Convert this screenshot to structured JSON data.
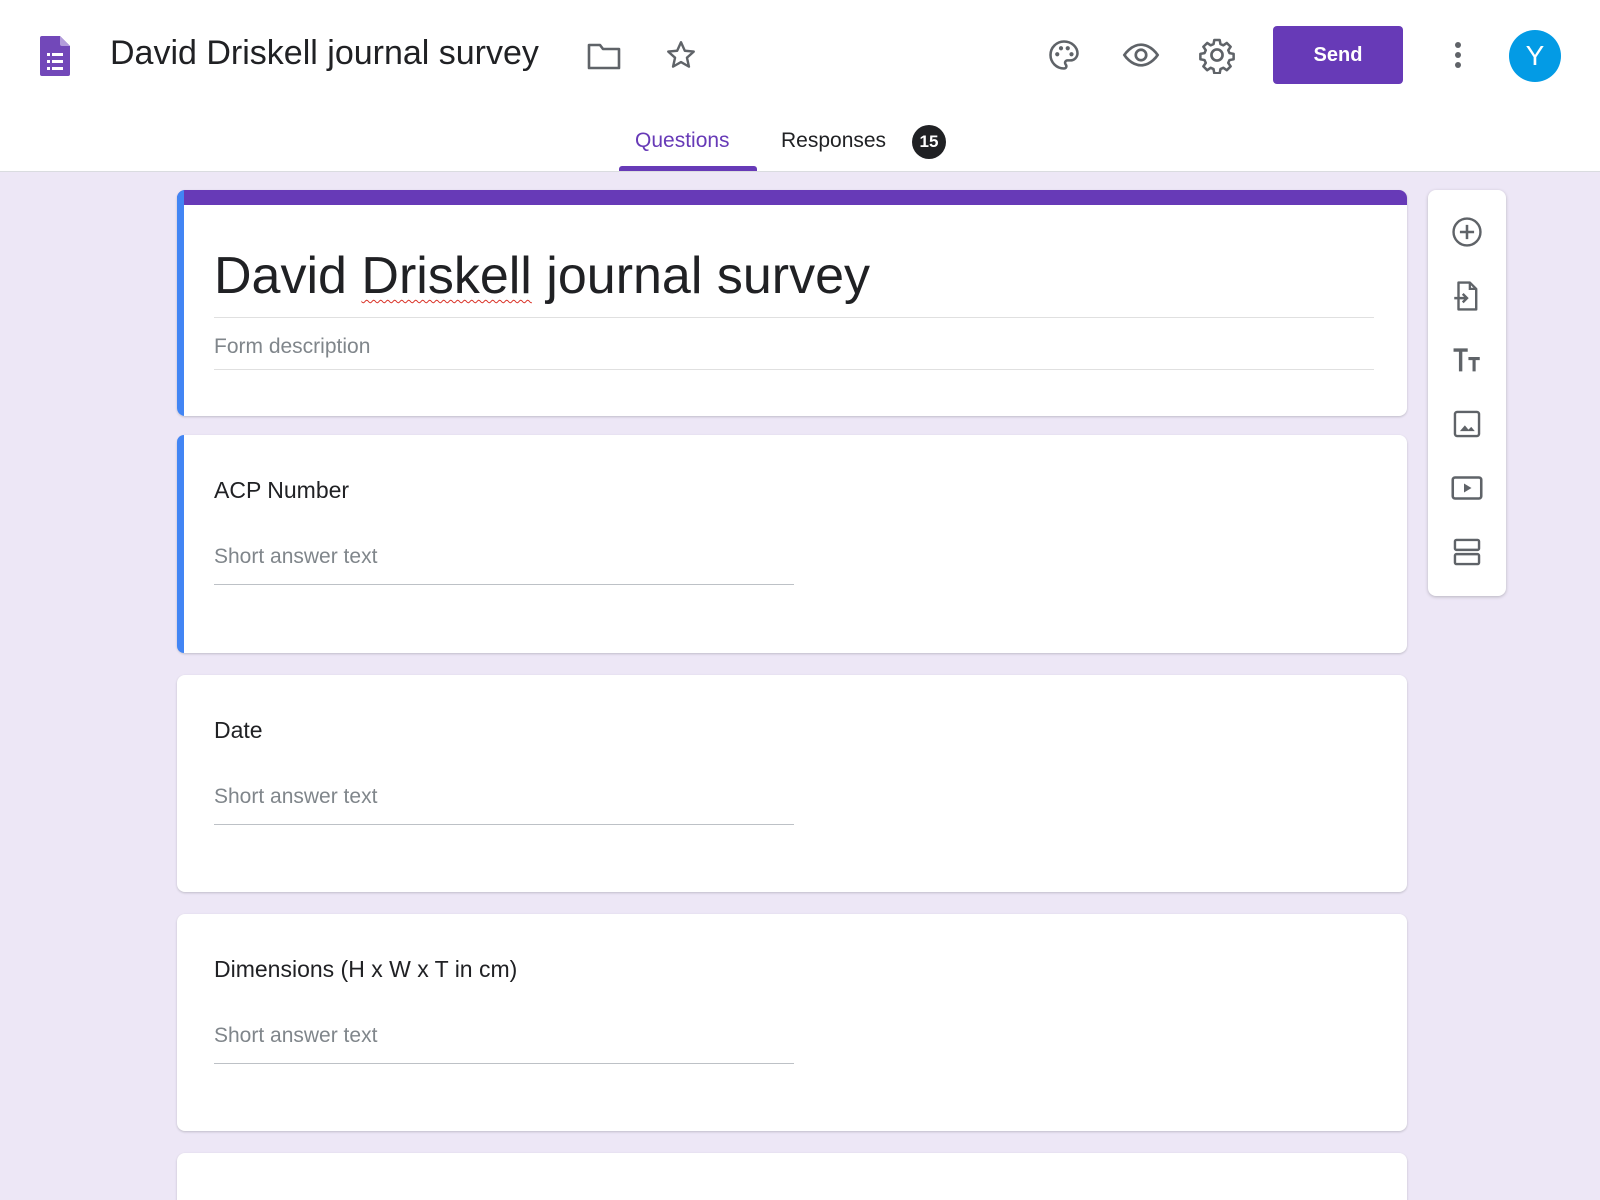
{
  "app": {
    "doc_title": "David Driskell journal survey",
    "send_label": "Send",
    "avatar_letter": "Y",
    "accent_color": "#673ab7"
  },
  "header_icons": [
    "folder-icon",
    "star-icon",
    "palette-icon",
    "preview-eye-icon",
    "settings-gear-icon",
    "more-vert-icon"
  ],
  "tabs": [
    {
      "label": "Questions",
      "active": true
    },
    {
      "label": "Responses",
      "badge": "15"
    }
  ],
  "form": {
    "title_pre": "David ",
    "title_spell": "Driskell",
    "title_post": " journal survey",
    "description_placeholder": "Form description"
  },
  "questions": [
    {
      "title": "ACP Number",
      "answer_placeholder": "Short answer text"
    },
    {
      "title": "Date",
      "answer_placeholder": "Short answer text"
    },
    {
      "title": "Dimensions (H x W x T in cm)",
      "answer_placeholder": "Short answer text"
    }
  ],
  "side_toolbar": [
    "add-question-icon",
    "import-questions-icon",
    "add-title-icon",
    "add-image-icon",
    "add-video-icon",
    "add-section-icon"
  ]
}
